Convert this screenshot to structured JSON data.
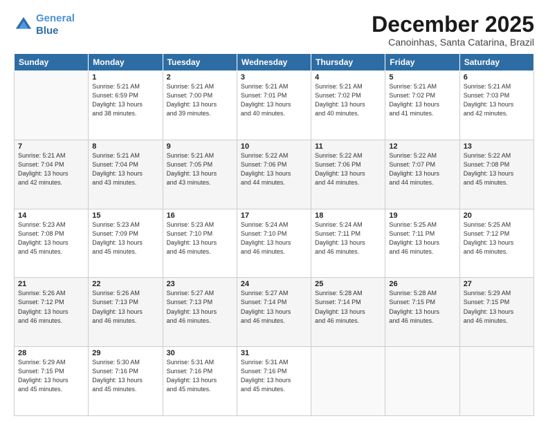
{
  "header": {
    "logo_line1": "General",
    "logo_line2": "Blue",
    "month": "December 2025",
    "location": "Canoinhas, Santa Catarina, Brazil"
  },
  "weekdays": [
    "Sunday",
    "Monday",
    "Tuesday",
    "Wednesday",
    "Thursday",
    "Friday",
    "Saturday"
  ],
  "weeks": [
    [
      {
        "day": "",
        "info": ""
      },
      {
        "day": "1",
        "info": "Sunrise: 5:21 AM\nSunset: 6:59 PM\nDaylight: 13 hours\nand 38 minutes."
      },
      {
        "day": "2",
        "info": "Sunrise: 5:21 AM\nSunset: 7:00 PM\nDaylight: 13 hours\nand 39 minutes."
      },
      {
        "day": "3",
        "info": "Sunrise: 5:21 AM\nSunset: 7:01 PM\nDaylight: 13 hours\nand 40 minutes."
      },
      {
        "day": "4",
        "info": "Sunrise: 5:21 AM\nSunset: 7:02 PM\nDaylight: 13 hours\nand 40 minutes."
      },
      {
        "day": "5",
        "info": "Sunrise: 5:21 AM\nSunset: 7:02 PM\nDaylight: 13 hours\nand 41 minutes."
      },
      {
        "day": "6",
        "info": "Sunrise: 5:21 AM\nSunset: 7:03 PM\nDaylight: 13 hours\nand 42 minutes."
      }
    ],
    [
      {
        "day": "7",
        "info": "Sunrise: 5:21 AM\nSunset: 7:04 PM\nDaylight: 13 hours\nand 42 minutes."
      },
      {
        "day": "8",
        "info": "Sunrise: 5:21 AM\nSunset: 7:04 PM\nDaylight: 13 hours\nand 43 minutes."
      },
      {
        "day": "9",
        "info": "Sunrise: 5:21 AM\nSunset: 7:05 PM\nDaylight: 13 hours\nand 43 minutes."
      },
      {
        "day": "10",
        "info": "Sunrise: 5:22 AM\nSunset: 7:06 PM\nDaylight: 13 hours\nand 44 minutes."
      },
      {
        "day": "11",
        "info": "Sunrise: 5:22 AM\nSunset: 7:06 PM\nDaylight: 13 hours\nand 44 minutes."
      },
      {
        "day": "12",
        "info": "Sunrise: 5:22 AM\nSunset: 7:07 PM\nDaylight: 13 hours\nand 44 minutes."
      },
      {
        "day": "13",
        "info": "Sunrise: 5:22 AM\nSunset: 7:08 PM\nDaylight: 13 hours\nand 45 minutes."
      }
    ],
    [
      {
        "day": "14",
        "info": "Sunrise: 5:23 AM\nSunset: 7:08 PM\nDaylight: 13 hours\nand 45 minutes."
      },
      {
        "day": "15",
        "info": "Sunrise: 5:23 AM\nSunset: 7:09 PM\nDaylight: 13 hours\nand 45 minutes."
      },
      {
        "day": "16",
        "info": "Sunrise: 5:23 AM\nSunset: 7:10 PM\nDaylight: 13 hours\nand 46 minutes."
      },
      {
        "day": "17",
        "info": "Sunrise: 5:24 AM\nSunset: 7:10 PM\nDaylight: 13 hours\nand 46 minutes."
      },
      {
        "day": "18",
        "info": "Sunrise: 5:24 AM\nSunset: 7:11 PM\nDaylight: 13 hours\nand 46 minutes."
      },
      {
        "day": "19",
        "info": "Sunrise: 5:25 AM\nSunset: 7:11 PM\nDaylight: 13 hours\nand 46 minutes."
      },
      {
        "day": "20",
        "info": "Sunrise: 5:25 AM\nSunset: 7:12 PM\nDaylight: 13 hours\nand 46 minutes."
      }
    ],
    [
      {
        "day": "21",
        "info": "Sunrise: 5:26 AM\nSunset: 7:12 PM\nDaylight: 13 hours\nand 46 minutes."
      },
      {
        "day": "22",
        "info": "Sunrise: 5:26 AM\nSunset: 7:13 PM\nDaylight: 13 hours\nand 46 minutes."
      },
      {
        "day": "23",
        "info": "Sunrise: 5:27 AM\nSunset: 7:13 PM\nDaylight: 13 hours\nand 46 minutes."
      },
      {
        "day": "24",
        "info": "Sunrise: 5:27 AM\nSunset: 7:14 PM\nDaylight: 13 hours\nand 46 minutes."
      },
      {
        "day": "25",
        "info": "Sunrise: 5:28 AM\nSunset: 7:14 PM\nDaylight: 13 hours\nand 46 minutes."
      },
      {
        "day": "26",
        "info": "Sunrise: 5:28 AM\nSunset: 7:15 PM\nDaylight: 13 hours\nand 46 minutes."
      },
      {
        "day": "27",
        "info": "Sunrise: 5:29 AM\nSunset: 7:15 PM\nDaylight: 13 hours\nand 46 minutes."
      }
    ],
    [
      {
        "day": "28",
        "info": "Sunrise: 5:29 AM\nSunset: 7:15 PM\nDaylight: 13 hours\nand 45 minutes."
      },
      {
        "day": "29",
        "info": "Sunrise: 5:30 AM\nSunset: 7:16 PM\nDaylight: 13 hours\nand 45 minutes."
      },
      {
        "day": "30",
        "info": "Sunrise: 5:31 AM\nSunset: 7:16 PM\nDaylight: 13 hours\nand 45 minutes."
      },
      {
        "day": "31",
        "info": "Sunrise: 5:31 AM\nSunset: 7:16 PM\nDaylight: 13 hours\nand 45 minutes."
      },
      {
        "day": "",
        "info": ""
      },
      {
        "day": "",
        "info": ""
      },
      {
        "day": "",
        "info": ""
      }
    ]
  ]
}
